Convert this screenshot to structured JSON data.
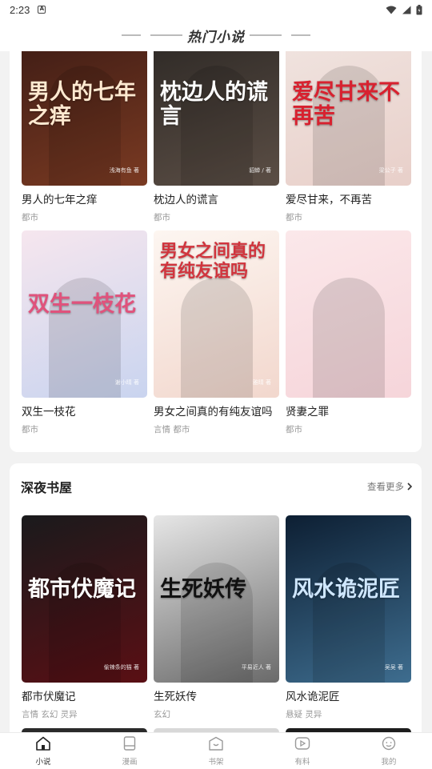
{
  "status_bar": {
    "time": "2:23",
    "notification_glyph": "A"
  },
  "header": {
    "title": "热门小说"
  },
  "hot_books": [
    {
      "title": "男人的七年之痒",
      "tags": "都市",
      "cover_title": "男人的七年之痒",
      "cover_author": "浅海有鱼 著",
      "colors": [
        "#3a1a14",
        "#7a3a22"
      ],
      "title_color": "#ffe9d0"
    },
    {
      "title": "枕边人的谎言",
      "tags": "都市",
      "cover_title": "枕边人的谎言",
      "cover_author": "貂蝉 / 著",
      "colors": [
        "#2a2623",
        "#5b4e45"
      ],
      "title_color": "#ffffff"
    },
    {
      "title": "爱尽甘来，不再苦",
      "tags": "都市",
      "cover_title": "爱尽甘来不再苦",
      "cover_author": "梁公子 著",
      "colors": [
        "#f1e6e2",
        "#e8cfc9"
      ],
      "title_color": "#d8212f"
    },
    {
      "title": "双生一枝花",
      "tags": "都市",
      "cover_title": "双生一枝花",
      "cover_author": "谢小晴 著",
      "colors": [
        "#f6e6ee",
        "#c9d4ef"
      ],
      "title_color": "#e0527c"
    },
    {
      "title": "男女之间真的有纯友谊吗",
      "tags": "言情 都市",
      "cover_title": "男女之间真的有纯友谊吗",
      "cover_author": "雅晴 著",
      "colors": [
        "#fdf6f1",
        "#f2d7cd"
      ],
      "title_color": "#d1343d"
    },
    {
      "title": "贤妻之罪",
      "tags": "都市",
      "cover_title": "",
      "cover_author": "",
      "colors": [
        "#fbe8ea",
        "#f6d5da"
      ],
      "title_color": "#c03050"
    }
  ],
  "night_section": {
    "title": "深夜书屋",
    "more_label": "查看更多",
    "books": [
      {
        "title": "都市伏魔记",
        "tags": "言情 玄幻 灵异",
        "cover_title": "都市伏魔记",
        "cover_author": "偷辣条的猫 著",
        "colors": [
          "#1a1a1c",
          "#5a0f14"
        ],
        "title_color": "#ffffff"
      },
      {
        "title": "生死妖传",
        "tags": "玄幻",
        "cover_title": "生死妖传",
        "cover_author": "平易近人 著",
        "colors": [
          "#e6e6e6",
          "#6a6a6a"
        ],
        "title_color": "#111111"
      },
      {
        "title": "风水诡泥匠",
        "tags": "悬疑 灵异",
        "cover_title": "风水诡泥匠",
        "cover_author": "吴吴 著",
        "colors": [
          "#0d1f33",
          "#3e6d8f"
        ],
        "title_color": "#cfe7ff"
      }
    ]
  },
  "tabbar": {
    "tabs": [
      {
        "label": "小说",
        "icon": "home-icon",
        "active": true
      },
      {
        "label": "漫画",
        "icon": "book-icon",
        "active": false
      },
      {
        "label": "书架",
        "icon": "bookshelf-icon",
        "active": false
      },
      {
        "label": "有料",
        "icon": "play-icon",
        "active": false
      },
      {
        "label": "我的",
        "icon": "profile-icon",
        "active": false
      }
    ]
  }
}
